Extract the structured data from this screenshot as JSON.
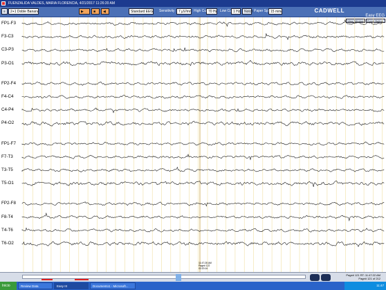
{
  "window": {
    "title": "FUENZALIDA VALDES, MARIA FLORENCIA, 4/21/2017 11:26:20 AM"
  },
  "toolbar": {
    "montage": "2+1 Doble Banana",
    "montage_view": "Standard EEG View",
    "sensitivity_label": "Sensitivity",
    "sensitivity_value": "7 µV/mm",
    "high_cut_label": "High Cut",
    "high_cut_value": "70 Hz",
    "low_cut_label": "Low Cut",
    "low_cut_value": "1 Hz",
    "notch_button": "Notch",
    "paper_speed_label": "Paper Speed",
    "paper_speed_value": "15 mm/sec",
    "brand": "CADWELL",
    "product": "Easy EEG",
    "view_window": "View Window",
    "event_button": "Event Button"
  },
  "channels": [
    "FP1-F3",
    "F3-C3",
    "C3-P3",
    "P3-O1",
    "FP2-F4",
    "F4-C4",
    "C4-P4",
    "P4-O2",
    "FP1-F7",
    "F7-T3",
    "T3-T5",
    "T5-O1",
    "FP2-F8",
    "F8-T4",
    "T4-T6",
    "T6-O2"
  ],
  "annotation": {
    "time": "11:47:28 AM",
    "page": "Page# 122",
    "clock": "00:20:16"
  },
  "status": {
    "page_line1": "Page# 121  RT: 11:47:22 AM",
    "page_line2": "Page# 121 of 212"
  },
  "taskbar": {
    "start": "Inicio",
    "tasks": [
      "Review Data",
      "Easy III",
      "Documento1 - Microsoft..."
    ],
    "clock": "11:47"
  },
  "colors": {
    "title_bg": "#1c3b8f",
    "toolbar_bg": "#4b70b6",
    "grid_yellow": "#f0dfa0",
    "trace": "#1a1a1a"
  }
}
